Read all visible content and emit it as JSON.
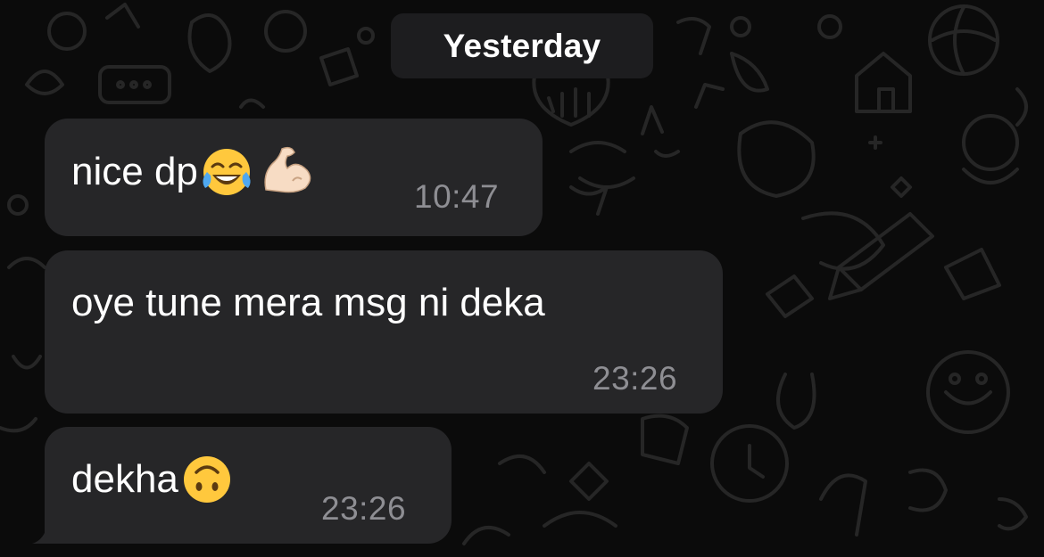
{
  "date_separator": "Yesterday",
  "messages": [
    {
      "text": "nice dp",
      "emojis": [
        "face-with-tears-of-joy-icon",
        "flexed-biceps-icon"
      ],
      "time": "10:47"
    },
    {
      "text": "oye tune mera msg ni deka",
      "emojis": [],
      "time": "23:26"
    },
    {
      "text": "dekha",
      "emojis": [
        "upside-down-face-icon"
      ],
      "time": "23:26"
    }
  ],
  "colors": {
    "background": "#0b0b0b",
    "bubble": "#262628",
    "date_chip": "#1d1d1f",
    "text": "#ffffff",
    "timestamp": "#8e8e93",
    "wallpaper_doodle": "#2a2a2a"
  }
}
